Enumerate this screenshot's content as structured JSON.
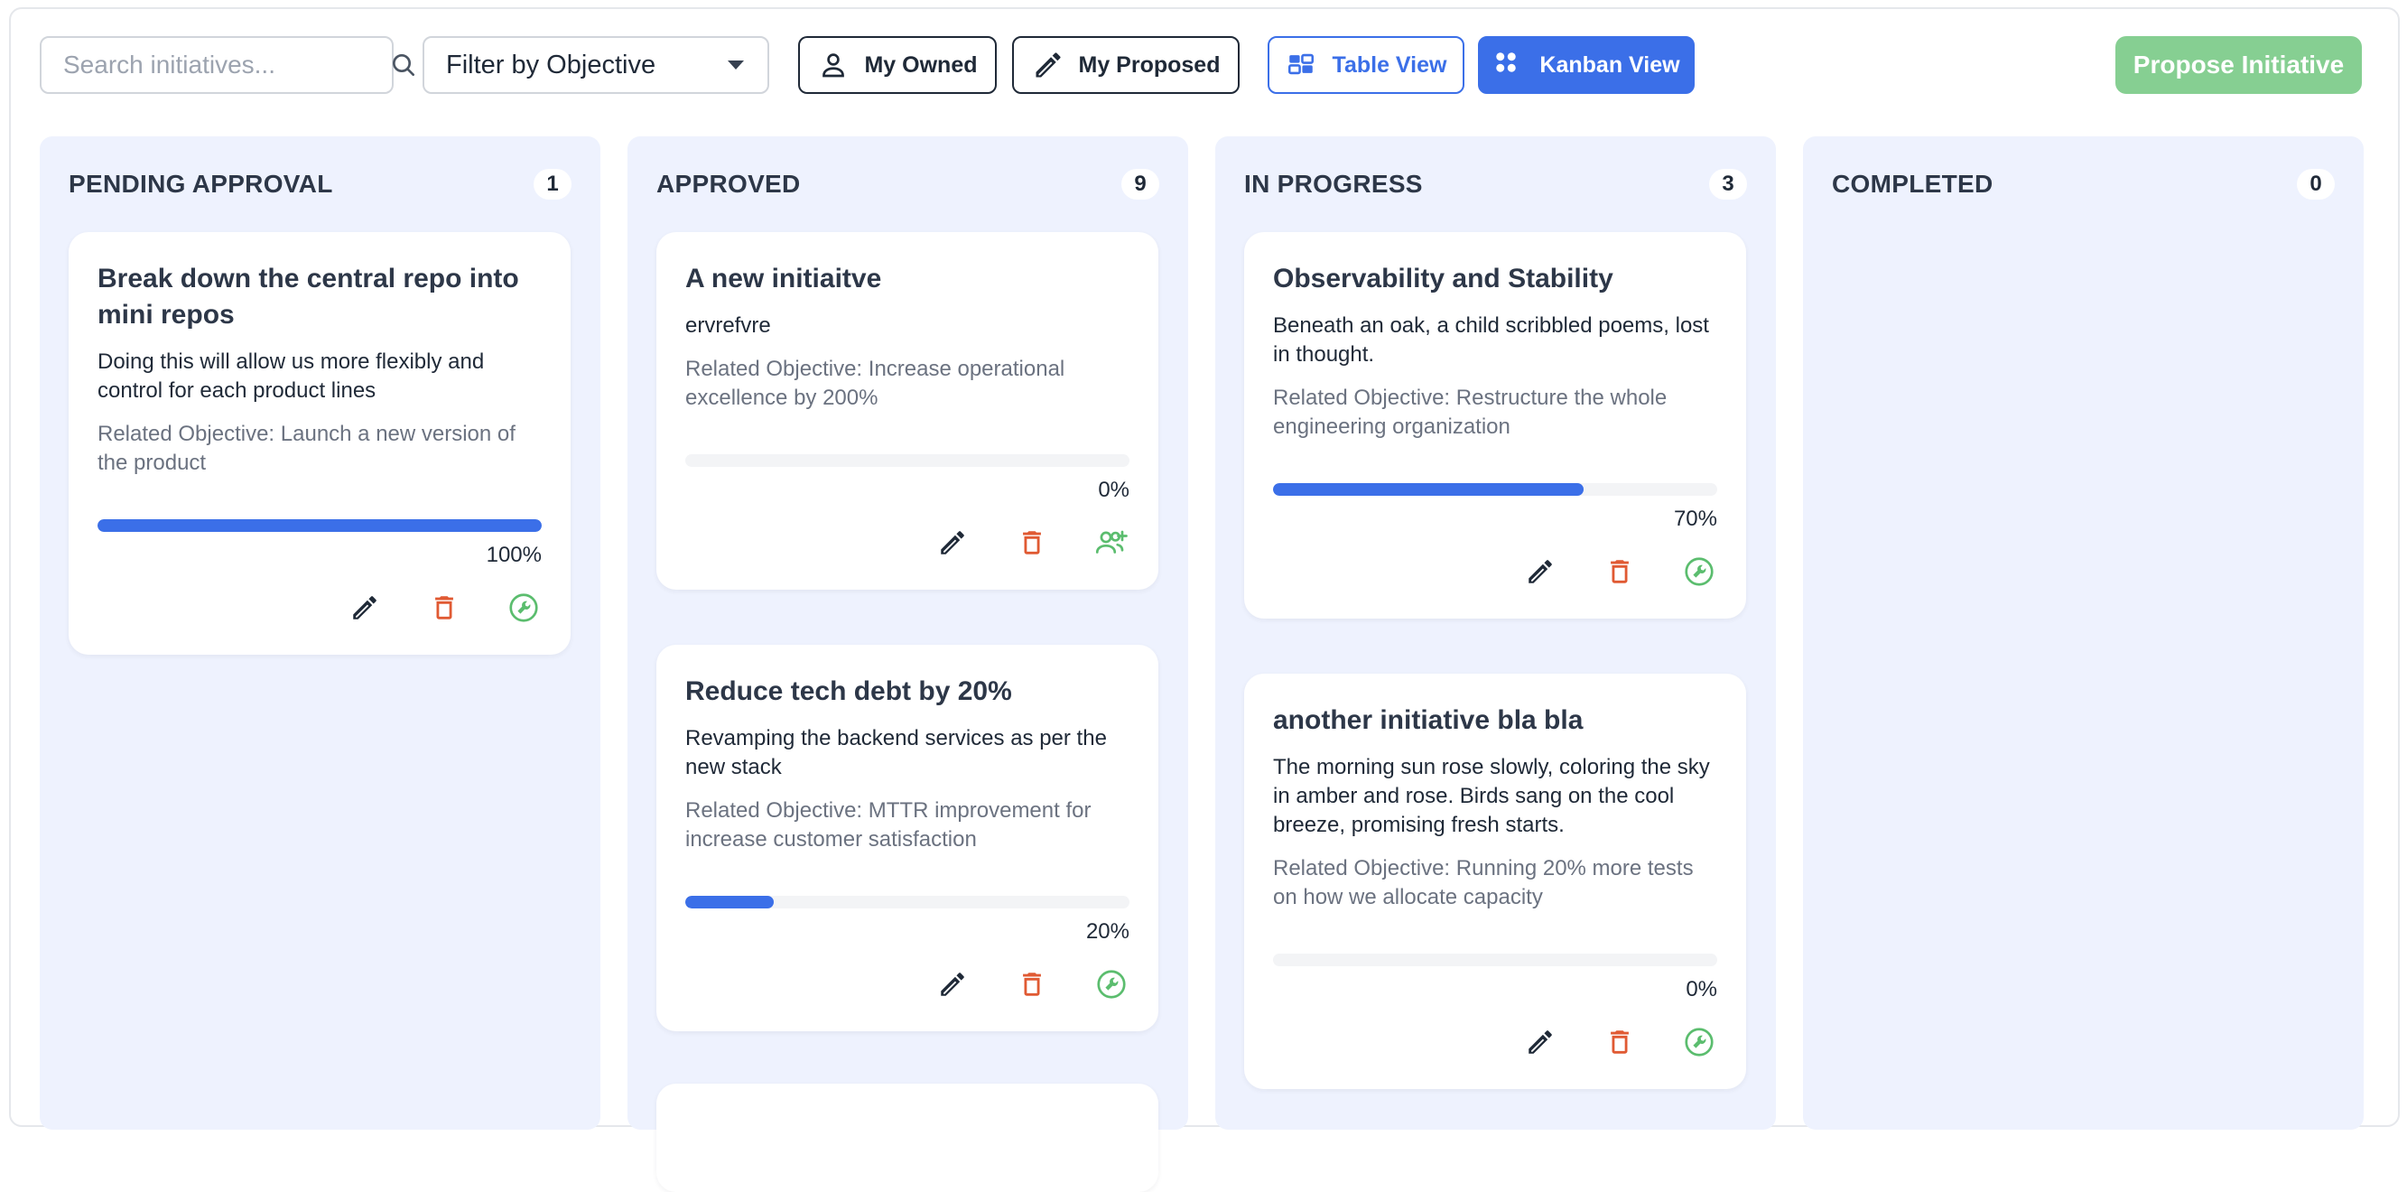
{
  "toolbar": {
    "search_placeholder": "Search initiatives...",
    "filter_label": "Filter by Objective",
    "my_owned": "My Owned",
    "my_proposed": "My Proposed",
    "table_view": "Table View",
    "kanban_view": "Kanban View",
    "propose_initiative": "Propose Initiative"
  },
  "colors": {
    "accent": "#3b6fe8",
    "column_bg": "#eef2fe",
    "delete": "#e05a33",
    "assign": "#5bbd6e",
    "propose_bg": "#86cf92"
  },
  "columns": [
    {
      "title": "PENDING APPROVAL",
      "count": "1",
      "cards": [
        {
          "title": "Break down the central repo into mini repos",
          "description": "Doing this will allow us more flexibly and control for each product lines",
          "objective": "Related Objective: Launch a new version of the product",
          "progress": 100,
          "progress_label": "100%",
          "icons": [
            "pencil-icon",
            "trash-icon",
            "wrench-circle-icon"
          ]
        }
      ]
    },
    {
      "title": "APPROVED",
      "count": "9",
      "cards": [
        {
          "title": "A new initiaitve",
          "description": "ervrefvre",
          "objective": "Related Objective: Increase operational excellence by 200%",
          "progress": 0,
          "progress_label": "0%",
          "icons": [
            "pencil-icon",
            "trash-icon",
            "add-user-icon"
          ]
        },
        {
          "title": "Reduce tech debt by 20%",
          "description": "Revamping the backend services as per the new stack",
          "objective": "Related Objective: MTTR improvement for increase customer satisfaction",
          "progress": 20,
          "progress_label": "20%",
          "icons": [
            "pencil-icon",
            "trash-icon",
            "wrench-circle-icon"
          ]
        }
      ]
    },
    {
      "title": "IN PROGRESS",
      "count": "3",
      "cards": [
        {
          "title": "Observability and Stability",
          "description": "Beneath an oak, a child scribbled poems, lost in thought.",
          "objective": "Related Objective: Restructure the whole engineering organization",
          "progress": 70,
          "progress_label": "70%",
          "icons": [
            "pencil-icon",
            "trash-icon",
            "wrench-circle-icon"
          ]
        },
        {
          "title": "another initiative bla bla",
          "description": "The morning sun rose slowly, coloring the sky in amber and rose. Birds sang on the cool breeze, promising fresh starts.",
          "objective": "Related Objective: Running 20% more tests on how we allocate capacity",
          "progress": 0,
          "progress_label": "0%",
          "icons": [
            "pencil-icon",
            "trash-icon",
            "wrench-circle-icon"
          ]
        }
      ]
    },
    {
      "title": "COMPLETED",
      "count": "0",
      "cards": []
    }
  ]
}
